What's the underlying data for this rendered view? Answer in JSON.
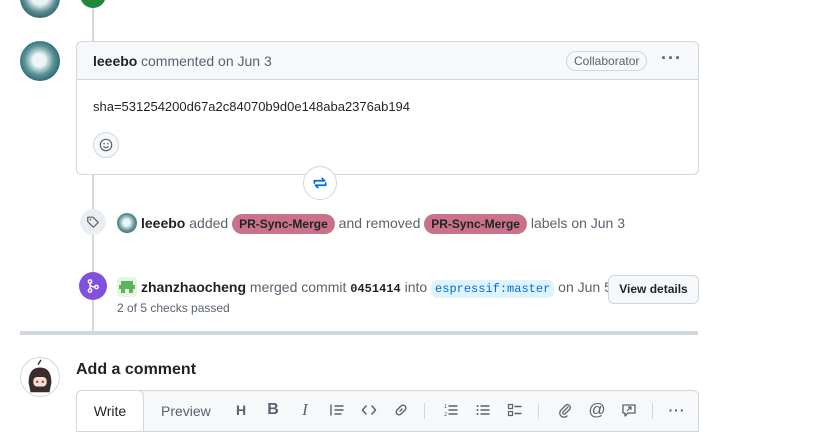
{
  "comment": {
    "author": "leeebo",
    "action": "commented on Jun 3",
    "badge": "Collaborator",
    "more_icon": "kebab-horizontal-icon",
    "body": "sha=531254200d67a2c84070b9d0e148aba2376ab194",
    "reaction_icon": "smiley-icon"
  },
  "label_event": {
    "icon": "tag-icon",
    "actor": "leeebo",
    "added_text": "added",
    "added_label": "PR-Sync-Merge",
    "removed_text": "and removed",
    "removed_label": "PR-Sync-Merge",
    "suffix": "labels on Jun 3",
    "label_color": "#c9728a"
  },
  "merge_event": {
    "icon": "git-merge-icon",
    "actor": "zhanzhaocheng",
    "merged_text": "merged commit",
    "commit": "0451414",
    "into_text": "into",
    "branch": "espressif:master",
    "date": "on Jun 5",
    "checks": "2 of 5 checks passed",
    "view_details": "View details",
    "icon_color": "#8250df"
  },
  "add_comment": {
    "title": "Add a comment",
    "tabs": [
      "Write",
      "Preview"
    ],
    "tools": [
      "heading-icon",
      "bold-icon",
      "italic-icon",
      "quote-icon",
      "code-icon",
      "link-icon",
      "ordered-list-icon",
      "unordered-list-icon",
      "task-list-icon",
      "attach-icon",
      "mention-icon",
      "reference-icon",
      "more-icon"
    ]
  },
  "top_event": {
    "icon_color": "#1f883d"
  }
}
